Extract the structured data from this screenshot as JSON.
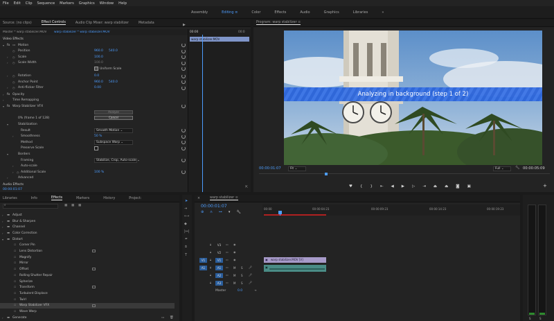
{
  "menu": [
    "File",
    "Edit",
    "Clip",
    "Sequence",
    "Markers",
    "Graphics",
    "Window",
    "Help"
  ],
  "workspaces": [
    "Assembly",
    "Editing",
    "Color",
    "Effects",
    "Audio",
    "Graphics",
    "Libraries"
  ],
  "workspace_active": "Editing",
  "workspace_more": "»",
  "effect_controls": {
    "tabs": [
      "Source: (no clips)",
      "Effect Controls",
      "Audio Clip Mixer: warp stabilizer",
      "Metadata"
    ],
    "active_tab": "Effect Controls",
    "master_label": "Master * warp stabilizer.MOV",
    "clip_label": "warp stabilizer * warp stabilizer.MOV",
    "ruler_start": "00:00",
    "ruler_end": "00:0",
    "clip_bar": "warp stabilizer.MOV",
    "section_video": "Video Effects",
    "motion": "Motion",
    "position": "Position",
    "position_x": "960.0",
    "position_y": "540.0",
    "scale": "Scale",
    "scale_v": "100.0",
    "scale_width": "Scale Width",
    "scale_width_v": "100.0",
    "uniform_scale": "Uniform Scale",
    "rotation": "Rotation",
    "rotation_v": "0.0",
    "anchor": "Anchor Point",
    "anchor_x": "960.0",
    "anchor_y": "540.0",
    "antiflicker": "Anti-flicker Filter",
    "antiflicker_v": "0.00",
    "opacity": "Opacity",
    "time_remap": "Time Remapping",
    "warp": "Warp Stabilizer VFX",
    "analyze_btn": "Analyze",
    "cancel_btn": "Cancel",
    "status": "0% (frame 1 of 128)",
    "stabilization": "Stabilization",
    "result": "Result",
    "result_v": "Smooth Motion",
    "smoothness": "Smoothness",
    "smoothness_v": "50 %",
    "method": "Method",
    "method_v": "Subspace Warp",
    "preserve": "Preserve Scale",
    "borders": "Borders",
    "framing": "Framing",
    "framing_v": "Stabilize, Crop, Auto-scale",
    "autoscale": "Auto-scale",
    "additional_scale": "Additional Scale",
    "additional_scale_v": "100 %",
    "advanced": "Advanced",
    "section_audio": "Audio Effects",
    "timecode": "00:00:01:07"
  },
  "program": {
    "title": "Program: warp stabilizer",
    "overlay_text": "Analyzing in background (step 1 of 2)",
    "timecode": "00:00:01:07",
    "fit": "Fit",
    "quality": "Full",
    "duration": "00:00:05:09"
  },
  "effects_panel": {
    "tabs": [
      "Libraries",
      "Info",
      "Effects",
      "Markers",
      "History",
      "Project:"
    ],
    "active_tab": "Effects",
    "items": [
      {
        "label": "Adjust",
        "type": "folder",
        "level": 1
      },
      {
        "label": "Blur & Sharpen",
        "type": "folder",
        "level": 1
      },
      {
        "label": "Channel",
        "type": "folder",
        "level": 1
      },
      {
        "label": "Color Correction",
        "type": "folder",
        "level": 1
      },
      {
        "label": "Distort",
        "type": "folder-open",
        "level": 1
      },
      {
        "label": "Corner Pin",
        "type": "effect",
        "level": 2
      },
      {
        "label": "Lens Distortion",
        "type": "effect",
        "level": 2,
        "accel": true
      },
      {
        "label": "Magnify",
        "type": "effect",
        "level": 2
      },
      {
        "label": "Mirror",
        "type": "effect",
        "level": 2
      },
      {
        "label": "Offset",
        "type": "effect",
        "level": 2,
        "accel": true
      },
      {
        "label": "Rolling Shutter Repair",
        "type": "effect",
        "level": 2
      },
      {
        "label": "Spherize",
        "type": "effect",
        "level": 2
      },
      {
        "label": "Transform",
        "type": "effect",
        "level": 2,
        "accel": true
      },
      {
        "label": "Turbulent Displace",
        "type": "effect",
        "level": 2
      },
      {
        "label": "Twirl",
        "type": "effect",
        "level": 2
      },
      {
        "label": "Warp Stabilizer VFX",
        "type": "effect",
        "level": 2,
        "accel": true,
        "selected": true
      },
      {
        "label": "Wave Warp",
        "type": "effect",
        "level": 2
      },
      {
        "label": "Generate",
        "type": "folder",
        "level": 1
      }
    ]
  },
  "timeline": {
    "tab": "warp stabilizer",
    "timecode": "00:00:01:07",
    "ruler": [
      "00:00",
      "00:00:04:23",
      "00:00:09:23",
      "00:00:14:23",
      "00:00:19:23"
    ],
    "video_tracks": [
      "V3",
      "V2",
      "V1"
    ],
    "audio_tracks": [
      "A1",
      "A2",
      "A3"
    ],
    "source_v": "V1",
    "source_a": "A1",
    "master": "Master",
    "master_v": "0.0",
    "video_clip": "warp stabilizer.MOV [V]",
    "track_m": "M",
    "track_s": "S"
  },
  "meter": {
    "s_labels": [
      "S",
      "S"
    ]
  },
  "colors": {
    "accent": "#4d9dff",
    "banner": "#2a63d8",
    "clip_video": "#a79ac9",
    "clip_audio": "#4a8c86"
  }
}
